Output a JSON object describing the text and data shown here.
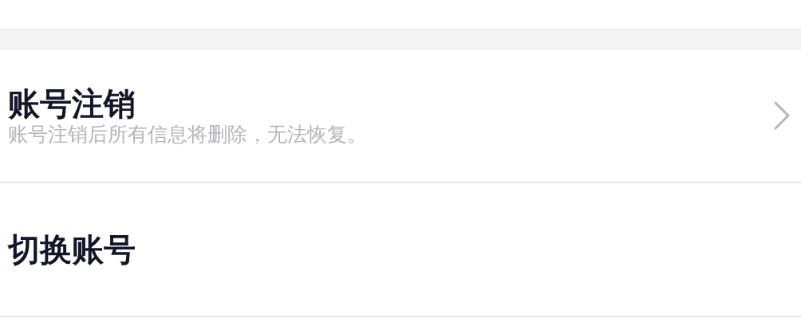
{
  "items": [
    {
      "kind": "link",
      "title": "账号注销",
      "subtitle": "账号注销后所有信息将删除，无法恢复。"
    },
    {
      "kind": "plain",
      "title": "切换账号"
    }
  ]
}
